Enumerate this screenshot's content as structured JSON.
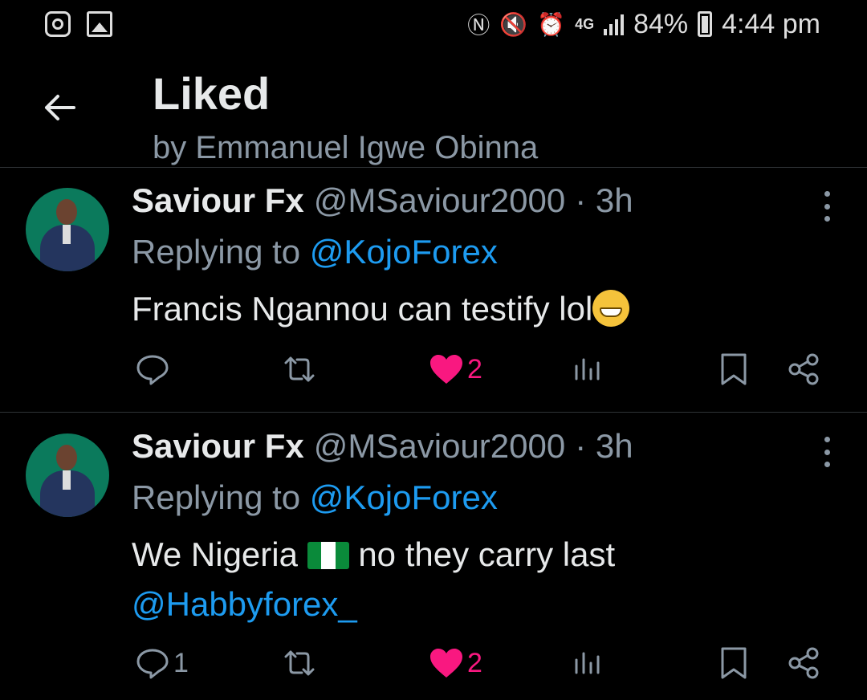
{
  "status_bar": {
    "left_icons": [
      "instagram-icon",
      "gallery-icon"
    ],
    "network": "4G",
    "battery": "84%",
    "time": "4:44 pm"
  },
  "header": {
    "title": "Liked",
    "subtitle": "by Emmanuel Igwe Obinna"
  },
  "tweets": [
    {
      "name": "Saviour Fx",
      "handle": "@MSaviour2000",
      "time": "· 3h",
      "reply_prefix": "Replying to",
      "reply_to": "@KojoForex",
      "text": "Francis Ngannou can testify lol",
      "emoji": "grinning-face-emoji",
      "actions": {
        "replies": "",
        "reposts": "",
        "likes": "2",
        "liked": true
      }
    },
    {
      "name": "Saviour Fx",
      "handle": "@MSaviour2000",
      "time": "· 3h",
      "reply_prefix": "Replying to",
      "reply_to": "@KojoForex",
      "text_part1": "We Nigeria",
      "flag": "nigeria-flag-emoji",
      "text_part2": "no they carry last",
      "mention": "@Habbyforex_",
      "actions": {
        "replies": "1",
        "reposts": "",
        "likes": "2",
        "liked": true
      }
    }
  ],
  "colors": {
    "background": "#000000",
    "text": "#e7e9ea",
    "secondary": "#8b98a5",
    "link": "#1d9bf0",
    "like": "#f91880"
  }
}
